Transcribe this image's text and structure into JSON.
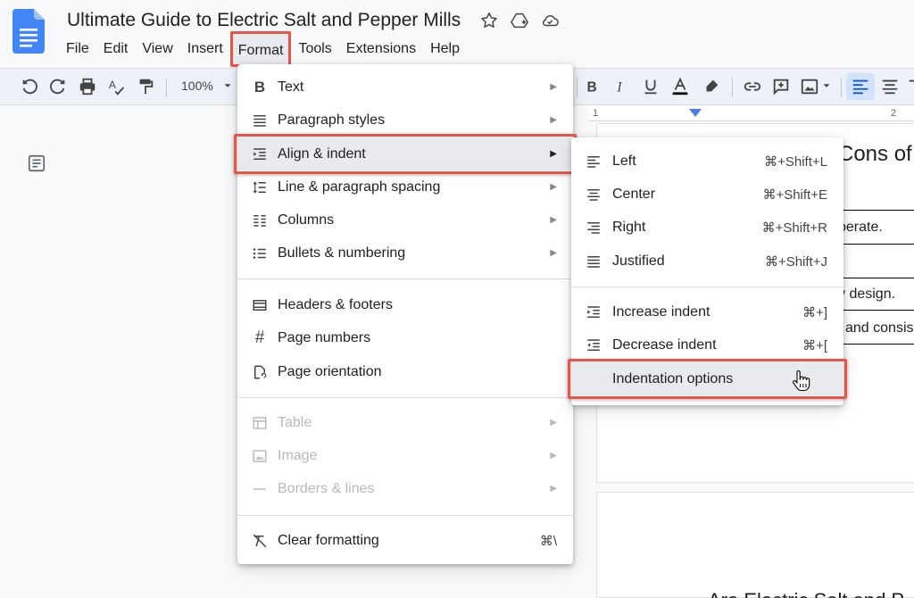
{
  "document": {
    "title": "Ultimate Guide to Electric Salt and Pepper Mills"
  },
  "menubar": [
    {
      "label": "File"
    },
    {
      "label": "Edit"
    },
    {
      "label": "View"
    },
    {
      "label": "Insert"
    },
    {
      "label": "Format"
    },
    {
      "label": "Tools"
    },
    {
      "label": "Extensions"
    },
    {
      "label": "Help"
    }
  ],
  "toolbar": {
    "zoom": "100%"
  },
  "ruler": {
    "mark_1": "1",
    "mark_2": "2"
  },
  "page_fragments": {
    "heading": "Cons of",
    "line1": "berate.",
    "line2": "y design.",
    "line3": "and consis",
    "bottom": "Are Electric Salt and P"
  },
  "format_menu": {
    "items": [
      {
        "label": "Text",
        "icon": "bold-icon"
      },
      {
        "label": "Paragraph styles",
        "icon": "paragraph-styles-icon"
      },
      {
        "label": "Align & indent",
        "icon": "align-indent-icon"
      },
      {
        "label": "Line & paragraph spacing",
        "icon": "line-spacing-icon"
      },
      {
        "label": "Columns",
        "icon": "columns-icon"
      },
      {
        "label": "Bullets & numbering",
        "icon": "bullets-icon"
      },
      {
        "label": "Headers & footers",
        "icon": "headers-footers-icon"
      },
      {
        "label": "Page numbers",
        "icon": "hash-icon"
      },
      {
        "label": "Page orientation",
        "icon": "page-orientation-icon"
      },
      {
        "label": "Table",
        "icon": "table-icon"
      },
      {
        "label": "Image",
        "icon": "image-icon"
      },
      {
        "label": "Borders & lines",
        "icon": "borders-icon"
      },
      {
        "label": "Clear formatting",
        "icon": "clear-formatting-icon",
        "shortcut": "⌘\\"
      }
    ]
  },
  "align_menu": {
    "items": [
      {
        "label": "Left",
        "shortcut": "⌘+Shift+L",
        "icon": "align-left-icon"
      },
      {
        "label": "Center",
        "shortcut": "⌘+Shift+E",
        "icon": "align-center-icon"
      },
      {
        "label": "Right",
        "shortcut": "⌘+Shift+R",
        "icon": "align-right-icon"
      },
      {
        "label": "Justified",
        "shortcut": "⌘+Shift+J",
        "icon": "align-justify-icon"
      },
      {
        "label": "Increase indent",
        "shortcut": "⌘+]",
        "icon": "indent-increase-icon"
      },
      {
        "label": "Decrease indent",
        "shortcut": "⌘+[",
        "icon": "indent-decrease-icon"
      },
      {
        "label": "Indentation options"
      }
    ]
  },
  "colors": {
    "highlight_border": "#e8564a",
    "docs_blue": "#4285f4",
    "toolbar_bg": "#eef2f8"
  }
}
